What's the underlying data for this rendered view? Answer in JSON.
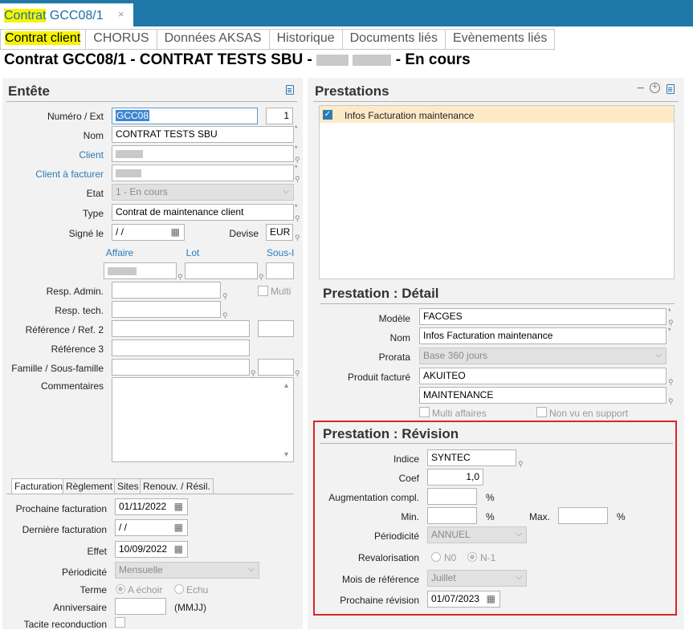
{
  "window_tab": {
    "label_highlight": "Contrat",
    "label_rest": " GCC08/1",
    "close": "×"
  },
  "subtabs": [
    "Contrat client",
    "CHORUS",
    "Données AKSAS",
    "Historique",
    "Documents liés",
    "Evènements liés"
  ],
  "title": {
    "prefix": "Contrat GCC08/1 - CONTRAT TESTS SBU - ",
    "suffix": " - En cours"
  },
  "entete": {
    "heading": "Entête",
    "numero_label": "Numéro / Ext",
    "numero_value": "GCC08",
    "ext_value": "1",
    "nom_label": "Nom",
    "nom_value": "CONTRAT TESTS SBU",
    "client_label": "Client",
    "client_facturer_label": "Client à facturer",
    "etat_label": "Etat",
    "etat_value": "1 - En cours",
    "type_label": "Type",
    "type_value": "Contrat de maintenance client",
    "signe_label": "Signé le",
    "signe_value": "  /   /",
    "devise_label": "Devise",
    "devise_value": "EUR",
    "affaire_label": "Affaire",
    "lot_label": "Lot",
    "souslot_label": "Sous-l",
    "resp_admin_label": "Resp. Admin.",
    "multi_label": "Multi",
    "resp_tech_label": "Resp. tech.",
    "ref_label": "Référence / Ref. 2",
    "ref3_label": "Référence 3",
    "famille_label": "Famille / Sous-famille",
    "commentaires_label": "Commentaires"
  },
  "bottom_tabs": [
    "Facturation",
    "Règlement",
    "Sites",
    "Renouv. / Résil."
  ],
  "facturation": {
    "prochaine_label": "Prochaine facturation",
    "prochaine_value": "01/11/2022",
    "derniere_label": "Dernière facturation",
    "derniere_value": "  /   /",
    "effet_label": "Effet",
    "effet_value": "10/09/2022",
    "periodicite_label": "Périodicité",
    "periodicite_value": "Mensuelle",
    "terme_label": "Terme",
    "terme_opt1": "A échoir",
    "terme_opt2": "Echu",
    "anniversaire_label": "Anniversaire",
    "anniversaire_hint": "(MMJJ)",
    "tacite_label": "Tacite reconduction"
  },
  "prestations": {
    "heading": "Prestations",
    "row1": "Infos Facturation maintenance"
  },
  "detail": {
    "heading": "Prestation : Détail",
    "modele_label": "Modèle",
    "modele_value": "FACGES",
    "nom_label": "Nom",
    "nom_value": "Infos Facturation maintenance",
    "prorata_label": "Prorata",
    "prorata_value": "Base 360 jours",
    "produit_label": "Produit facturé",
    "produit_value1": "AKUITEO",
    "produit_value2": "MAINTENANCE",
    "multi_affaires": "Multi affaires",
    "non_vu": "Non vu en support"
  },
  "revision": {
    "heading": "Prestation : Révision",
    "indice_label": "Indice",
    "indice_value": "SYNTEC",
    "coef_label": "Coef",
    "coef_value": "1,0",
    "aug_label": "Augmentation compl.",
    "pct": "%",
    "min_label": "Min.",
    "max_label": "Max.",
    "periodicite_label": "Périodicité",
    "periodicite_value": "ANNUEL",
    "revalo_label": "Revalorisation",
    "revalo_opt1": "N0",
    "revalo_opt2": "N-1",
    "mois_label": "Mois de référence",
    "mois_value": "Juillet",
    "prochaine_label": "Prochaine révision",
    "prochaine_value": "01/07/2023"
  },
  "icons": [
    "close-icon",
    "document-icon",
    "minus-icon",
    "plus-circle-icon",
    "calendar-icon",
    "chevron-down-icon",
    "checkbox-checked-icon",
    "scroll-arrow-icon"
  ],
  "colors": {
    "header_blue": "#1e78a8",
    "label_blue": "#2b7bb9",
    "highlight": "#f6f400",
    "revision_border": "#d9262a",
    "selected_row": "#fdebc8"
  }
}
